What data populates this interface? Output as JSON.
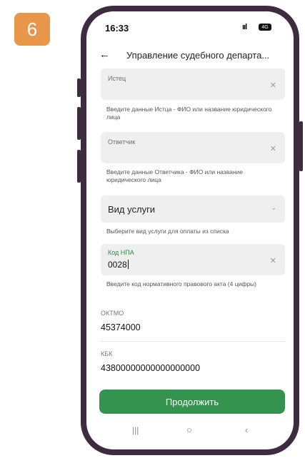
{
  "step_number": "6",
  "status_bar": {
    "time": "16:33",
    "signal": "ııl",
    "battery": "4G"
  },
  "header": {
    "title": "Управление судебного департа..."
  },
  "fields": {
    "plaintiff": {
      "label": "Истец",
      "hint": "Введите данные Истца - ФИО или название юридического лица"
    },
    "defendant": {
      "label": "Ответчик",
      "hint": "Введите данные Ответчика - ФИО или название юридического лица"
    },
    "service_type": {
      "value": "Вид услуги",
      "hint": "Выберите вид услуги для оплаты из списка"
    },
    "npa_code": {
      "label": "Код НПА",
      "value": "0028",
      "hint": "Введите код нормативного правового акта (4 цифры)"
    }
  },
  "oktmo": {
    "label": "ОКТМО",
    "value": "45374000"
  },
  "kbk": {
    "label": "КБК",
    "value": "43800000000000000000"
  },
  "continue_button": {
    "label": "Продолжить"
  },
  "colors": {
    "accent": "#34934e",
    "badge": "#e8974a",
    "phone_frame": "#3e2b3f"
  }
}
